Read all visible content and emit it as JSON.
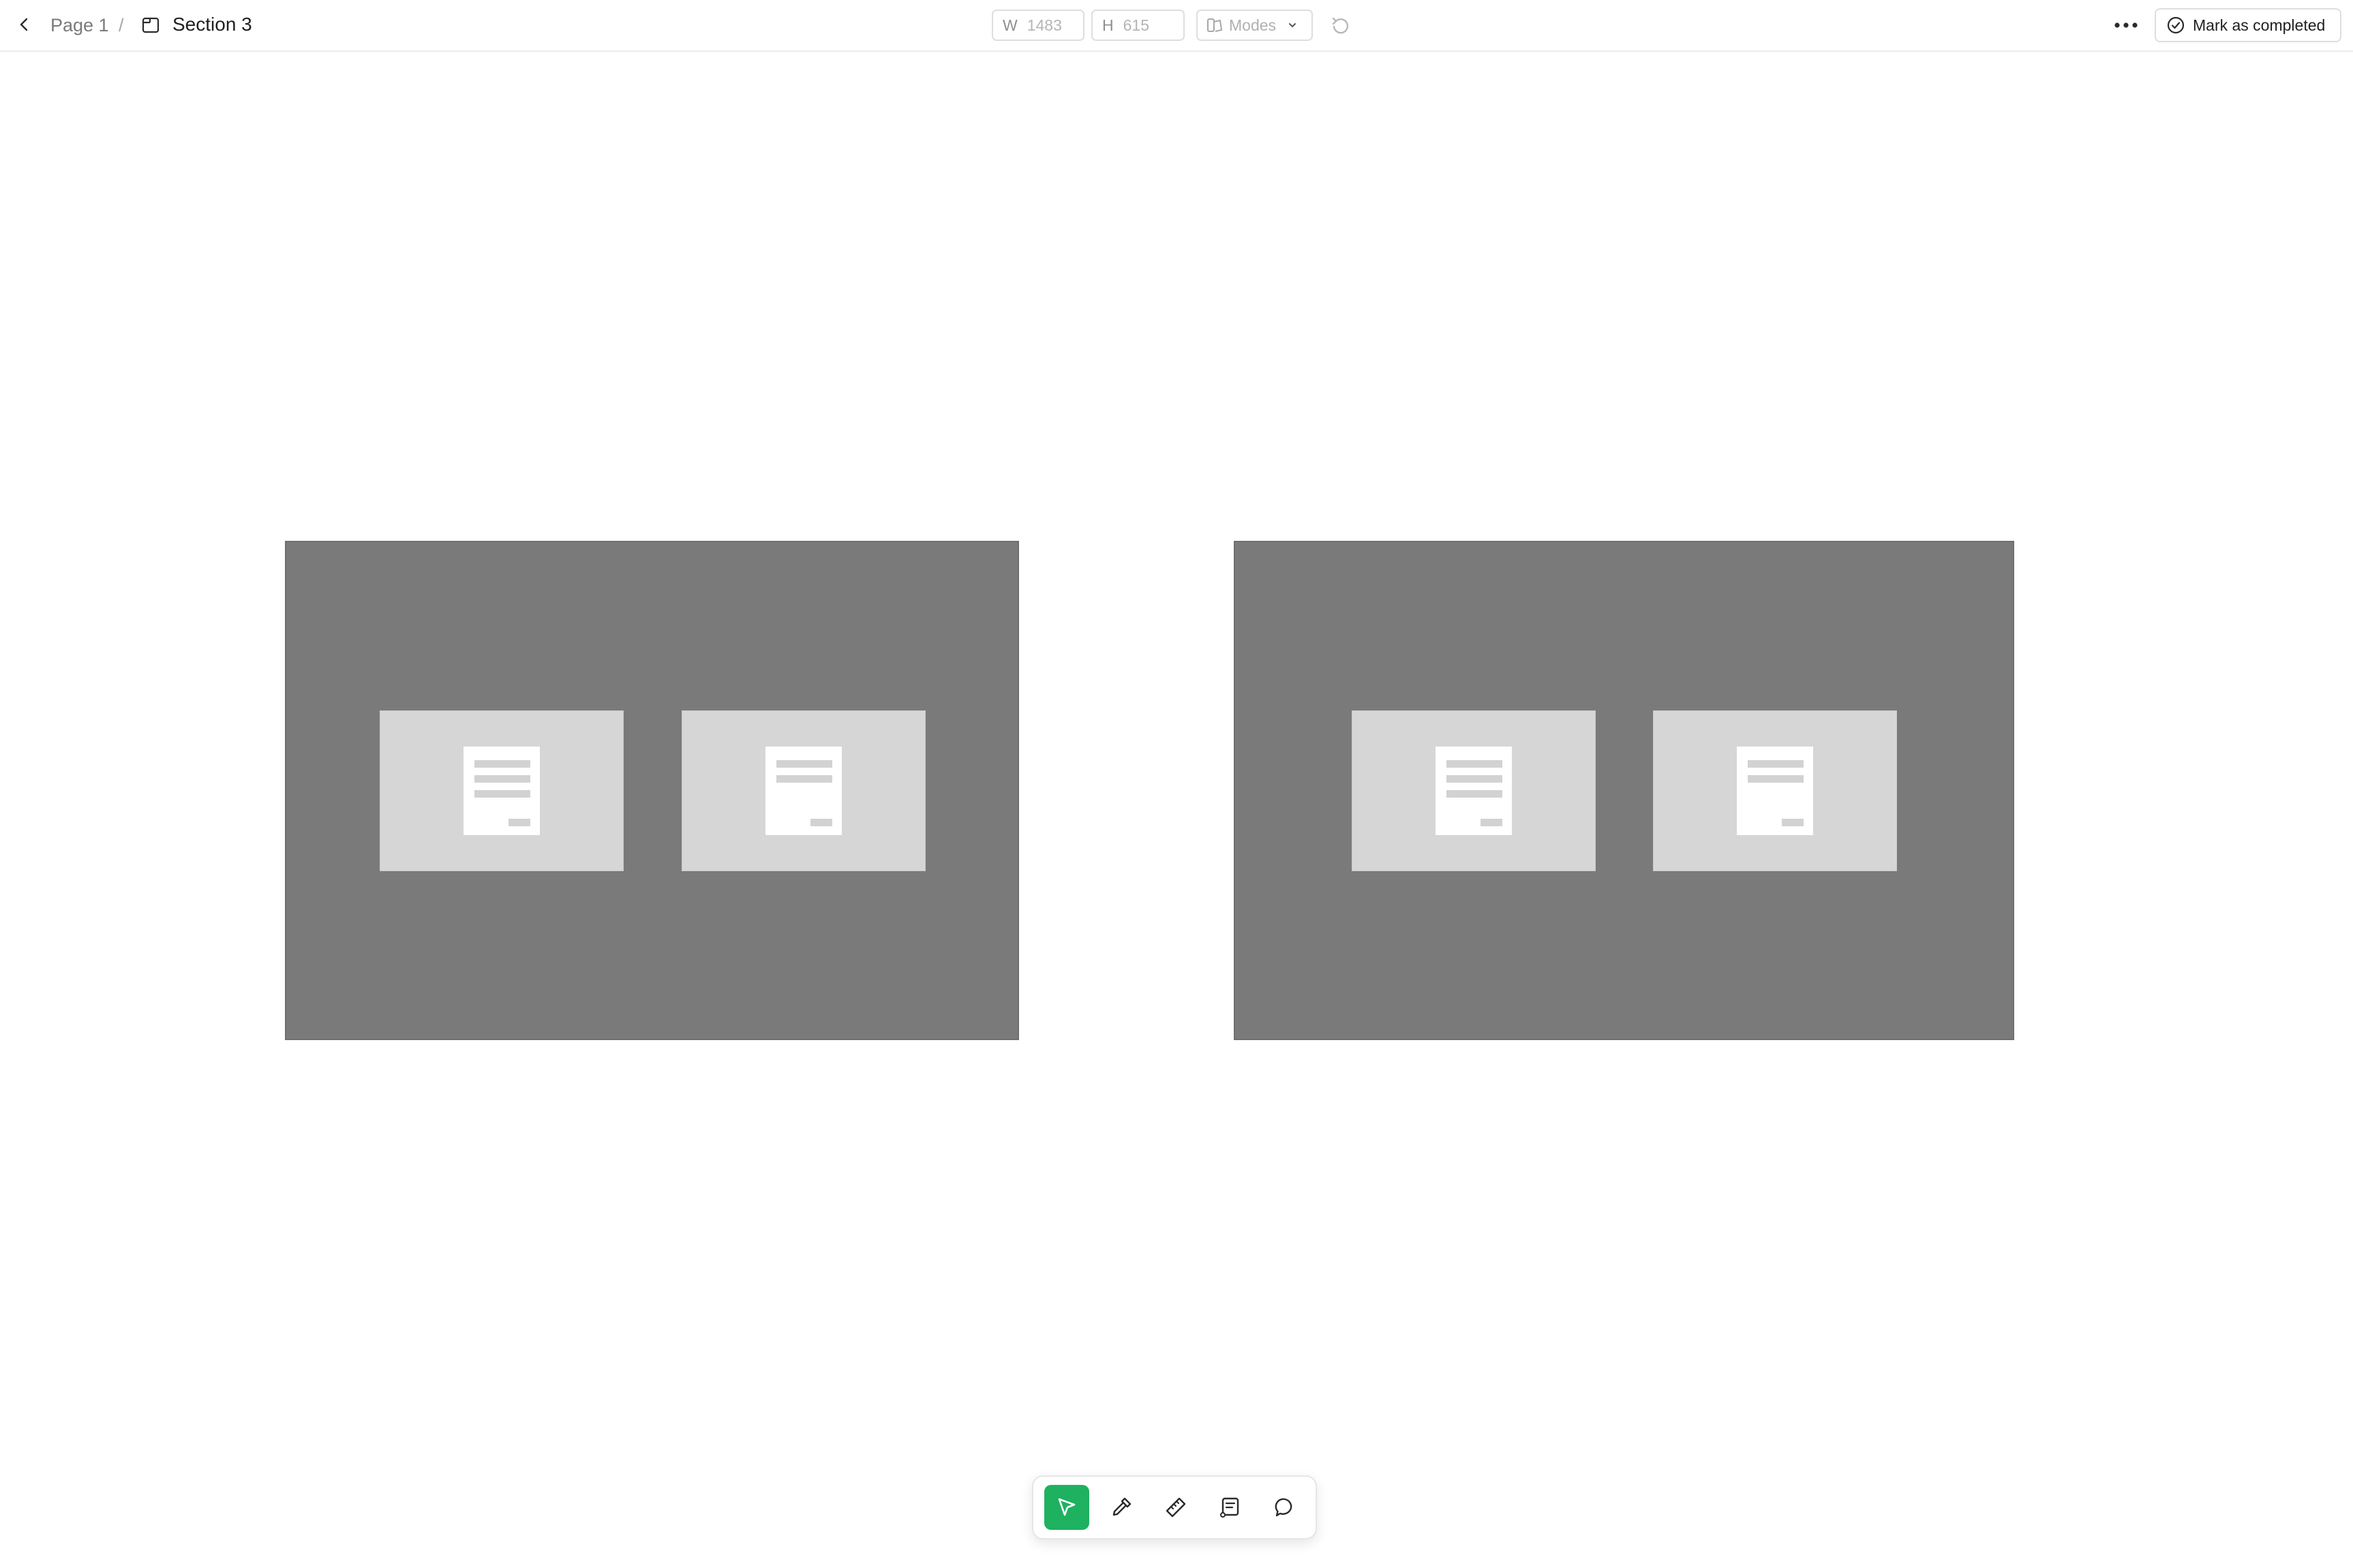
{
  "header": {
    "breadcrumb_page": "Page 1",
    "breadcrumb_separator": "/",
    "section_title": "Section 3",
    "width_label": "W",
    "width_value": "1483",
    "height_label": "H",
    "height_value": "615",
    "modes_label": "Modes",
    "complete_label": "Mark as completed"
  },
  "canvas": {
    "background": "#ffffff",
    "frame_color": "#7a7a7a",
    "placeholder_color": "#d6d6d6",
    "frames": [
      {
        "placeholders": [
          "image-placeholder",
          "image-placeholder"
        ]
      },
      {
        "placeholders": [
          "image-placeholder",
          "image-placeholder"
        ]
      }
    ]
  },
  "toolbar": {
    "accent": "#1db160",
    "tools": [
      "select-tool-icon",
      "eyedropper-tool-icon",
      "ruler-tool-icon",
      "annotation-tool-icon",
      "comment-tool-icon"
    ],
    "active_tool": "select-tool-icon"
  }
}
